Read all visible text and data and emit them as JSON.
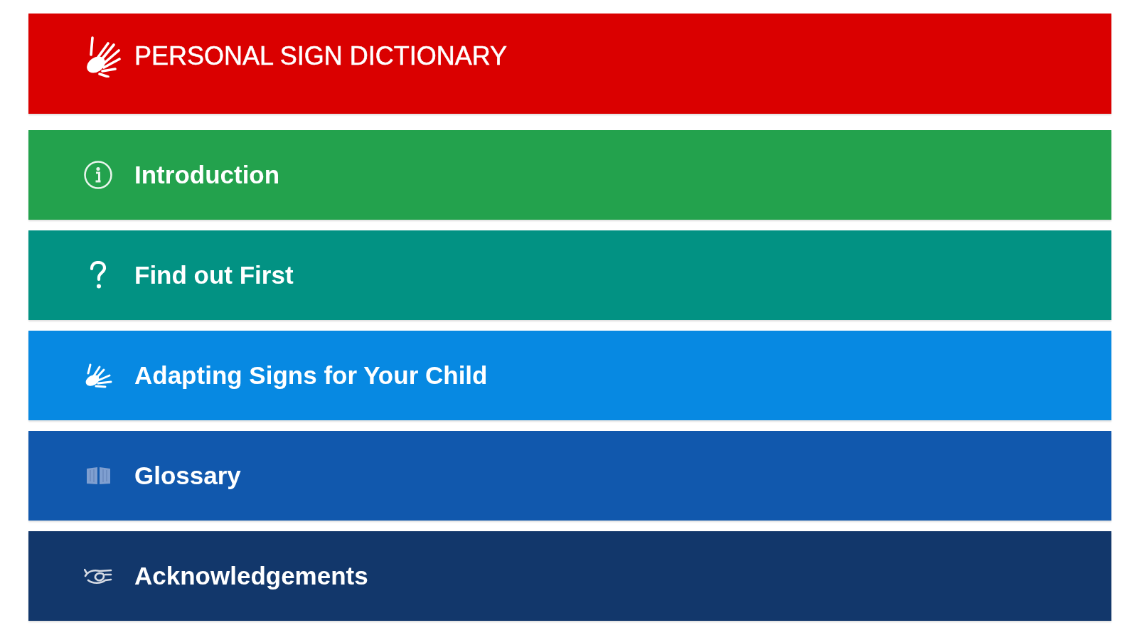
{
  "header": {
    "title": "PERSONAL SIGN DICTIONARY"
  },
  "menu": [
    {
      "label": "Introduction",
      "color": "#23a24d"
    },
    {
      "label": "Find out First",
      "color": "#029283"
    },
    {
      "label": "Adapting Signs for Your Child",
      "color": "#0789e2"
    },
    {
      "label": "Glossary",
      "color": "#1158ad"
    },
    {
      "label": "Acknowledgements",
      "color": "#12376b"
    }
  ]
}
